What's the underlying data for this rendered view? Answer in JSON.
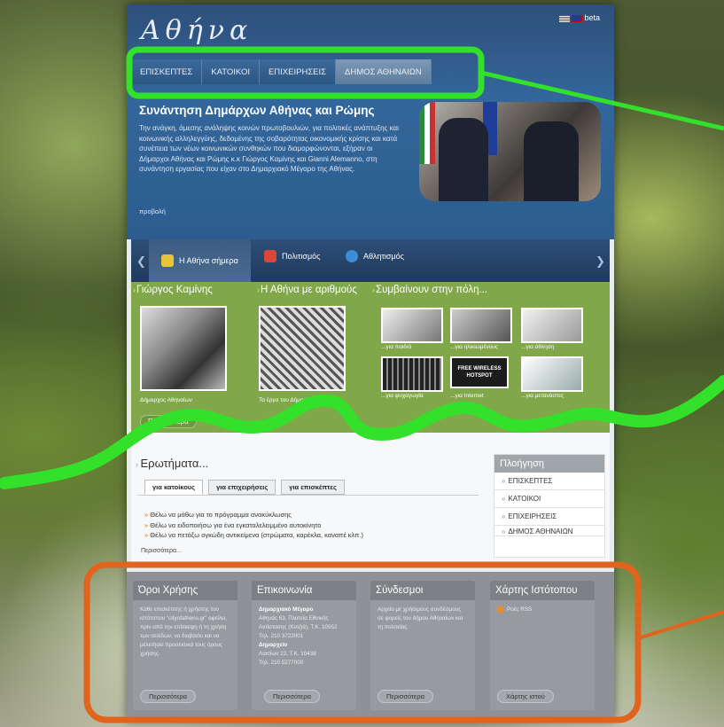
{
  "site": {
    "logo": "Αθήνα",
    "lang_label": "beta"
  },
  "nav": [
    {
      "label": "ΕΠΙΣΚΕΠΤΕΣ"
    },
    {
      "label": "ΚΑΤΟΙΚΟΙ"
    },
    {
      "label": "ΕΠΙΧΕΙΡΗΣΕΙΣ"
    },
    {
      "label": "ΔΗΜΟΣ ΑΘΗΝΑΙΩΝ"
    }
  ],
  "hero": {
    "title": "Συνάντηση Δημάρχων Αθήνας και Ρώμης",
    "text": "Την ανάγκη, άμεσης ανάληψης κοινών πρωτοβουλιών, για πολιτικές ανάπτυξης και κοινωνικής αλληλεγγύης, δεδομένης της σοβαρότητας οικονομικής κρίσης και κατά συνέπεια των νέων κοινωνικών συνθηκών που διαμορφώνονται, εξήραν οι Δήμαρχοι Αθήνας και Ρώμης κ.κ Γιώργος Καμίνης και Gianni Alemanno, στη συνάντηση εργασίας που είχαν στο Δημαρχιακό Μέγαρο της Αθήνας.",
    "link": "προβολή"
  },
  "tabs": [
    {
      "label": "Η Αθήνα σήμερα"
    },
    {
      "label": "Πολιτισμός"
    },
    {
      "label": "Αθλητισμός"
    }
  ],
  "green": {
    "col1_title": "Γιώργος Καμίνης",
    "col1_caption": "Δήμαρχος Αθηναίων",
    "col2_title": "Η Αθήνα με αριθμούς",
    "col2_caption": "Τα έργα του Δήμου Αθηναίων",
    "col3_title": "Συμβαίνουν στην πόλη...",
    "more": "Περισσότερα",
    "items": [
      {
        "caption": "...για παιδιά"
      },
      {
        "caption": "...για ηλικιωμένους"
      },
      {
        "caption": "...για άθληση"
      },
      {
        "caption": "...για ψυχαγωγία"
      },
      {
        "caption": "...για Internet"
      },
      {
        "caption": "...για μετανάστες"
      }
    ],
    "wifi_text": "FREE WIRELESS HOTSPOT"
  },
  "faq": {
    "title": "Ερωτήματα...",
    "tabs": [
      "για κατοίκους",
      "για επιχειρήσεις",
      "για επισκέπτες"
    ],
    "items": [
      "Θέλω να μάθω για το πρόγραμμα ανακύκλωσης",
      "Θέλω να ειδοποιήσω για ένα εγκαταλελειμμένο αυτοκίνητο",
      "Θέλω να πετάξω ογκώδη αντικείμενα (στρώματα, καρέκλα, καναπέ κλπ.)"
    ],
    "more": "Περισσότερα..."
  },
  "side_nav": {
    "title": "Πλοήγηση",
    "items": [
      "ΕΠΙΣΚΕΠΤΕΣ",
      "ΚΑΤΟΙΚΟΙ",
      "ΕΠΙΧΕΙΡΗΣΕΙΣ",
      "ΔΗΜΟΣ ΑΘΗΝΑΙΩΝ"
    ]
  },
  "footer": {
    "terms": {
      "title": "Όροι Χρήσης",
      "text": "Κάθε επισκέπτης ή χρήστης του ιστότοπου \"cityofathens.gr\" οφείλει, πριν από την επίσκεψη ή τη χρήση των σελίδων, να διαβάσει και να μελετήσει προσεκτικά τους όρους χρήσης.",
      "button": "Περισσότερα"
    },
    "contact": {
      "title": "Επικοινωνία",
      "l1": "Δημαρχιακό Μέγαρο",
      "l2": "Αθηνάς 63, Πλατεία Εθνικής Αντίστασης (Κοτζιά), Τ.Κ. 10552",
      "l3": "Τηλ. 210 3722001",
      "l4": "Δημαρχείο",
      "l5": "Λιοσίων 22, Τ.Κ. 10438",
      "l6": "Τηλ. 210 5277000",
      "button": "Περισσότερα"
    },
    "links": {
      "title": "Σύνδεσμοι",
      "text": "Αρχείο με χρήσιμους συνδέσμους σε φορείς του δήμου Αθηναίων και τη πολιτείας.",
      "button": "Περισσότερα"
    },
    "sitemap": {
      "title": "Χάρτης Ιστότοπου",
      "rss": "Ροές RSS",
      "button": "Χάρτης ιστού"
    }
  },
  "colors": {
    "annotation_green": "#33e02a",
    "annotation_orange": "#e0641e"
  }
}
